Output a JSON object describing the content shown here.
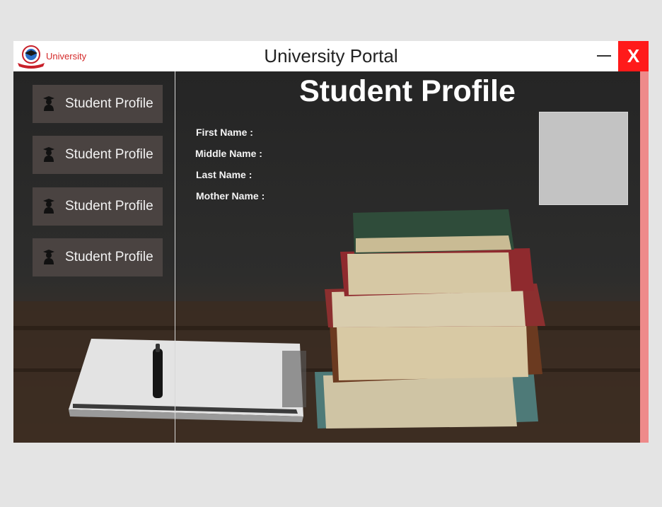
{
  "window": {
    "brand": "University",
    "title": "University Portal",
    "close_label": "X",
    "icons": {
      "logo": "university-logo",
      "minimize": "minimize-icon",
      "user": "student-icon"
    }
  },
  "sidebar": {
    "items": [
      {
        "label": "Student Profile"
      },
      {
        "label": "Student Profile"
      },
      {
        "label": "Student Profile"
      },
      {
        "label": "Student Profile"
      }
    ]
  },
  "main": {
    "heading": "Student Profile",
    "fields": [
      {
        "label": "First Name :"
      },
      {
        "label": "Middle Name :"
      },
      {
        "label": "Last Name :"
      },
      {
        "label": "Mother Name :"
      }
    ]
  },
  "colors": {
    "close_bg": "#ff1a1a",
    "brand_text": "#d42a2a",
    "accent_bar": "#ee8a8a",
    "sidebar_button": "#4a4341",
    "photo_placeholder": "#c3c3c3"
  }
}
